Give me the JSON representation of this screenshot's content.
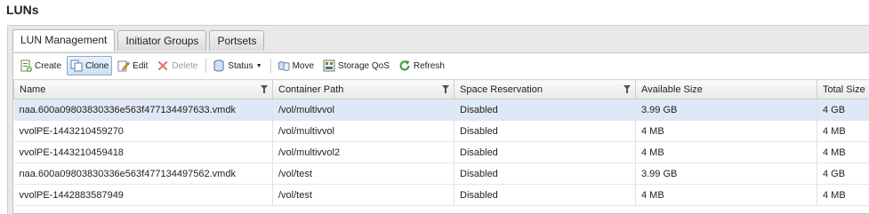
{
  "page": {
    "title": "LUNs"
  },
  "tabs": [
    {
      "label": "LUN Management",
      "active": true
    },
    {
      "label": "Initiator Groups",
      "active": false
    },
    {
      "label": "Portsets",
      "active": false
    }
  ],
  "toolbar": {
    "create": "Create",
    "clone": "Clone",
    "edit": "Edit",
    "delete": "Delete",
    "status": "Status",
    "move": "Move",
    "storage_qos": "Storage QoS",
    "refresh": "Refresh"
  },
  "table": {
    "columns": [
      "Name",
      "Container Path",
      "Space Reservation",
      "Available Size",
      "Total Size"
    ],
    "rows": [
      [
        "naa.600a09803830336e563f477134497633.vmdk",
        "/vol/multivvol",
        "Disabled",
        "3.99 GB",
        "4 GB"
      ],
      [
        "vvolPE-1443210459270",
        "/vol/multivvol",
        "Disabled",
        "4 MB",
        "4 MB"
      ],
      [
        "vvolPE-1443210459418",
        "/vol/multivvol2",
        "Disabled",
        "4 MB",
        "4 MB"
      ],
      [
        "naa.600a09803830336e563f477134497562.vmdk",
        "/vol/test",
        "Disabled",
        "3.99 GB",
        "4 GB"
      ],
      [
        "vvolPE-1442883587949",
        "/vol/test",
        "Disabled",
        "4 MB",
        "4 MB"
      ]
    ],
    "selected_row": 0
  },
  "colors": {
    "selection": "#dfe8f6",
    "accent": "#3b7bd3",
    "refresh_green": "#3a9a3a",
    "delete_red": "#d33"
  }
}
